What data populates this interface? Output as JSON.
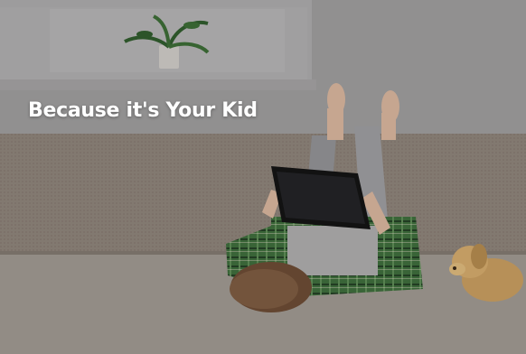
{
  "hero": {
    "headline": "Because it's Your Kid"
  },
  "colors": {
    "wall": "#9b999a",
    "sofa": "#8a7f76",
    "cushion": "#9d968f",
    "shirt_plaid": "#3f6a3c",
    "tablet": "#141414",
    "headline_text": "#ffffff"
  },
  "icons": [
    "potted-plant",
    "tablet",
    "plush-dog"
  ]
}
